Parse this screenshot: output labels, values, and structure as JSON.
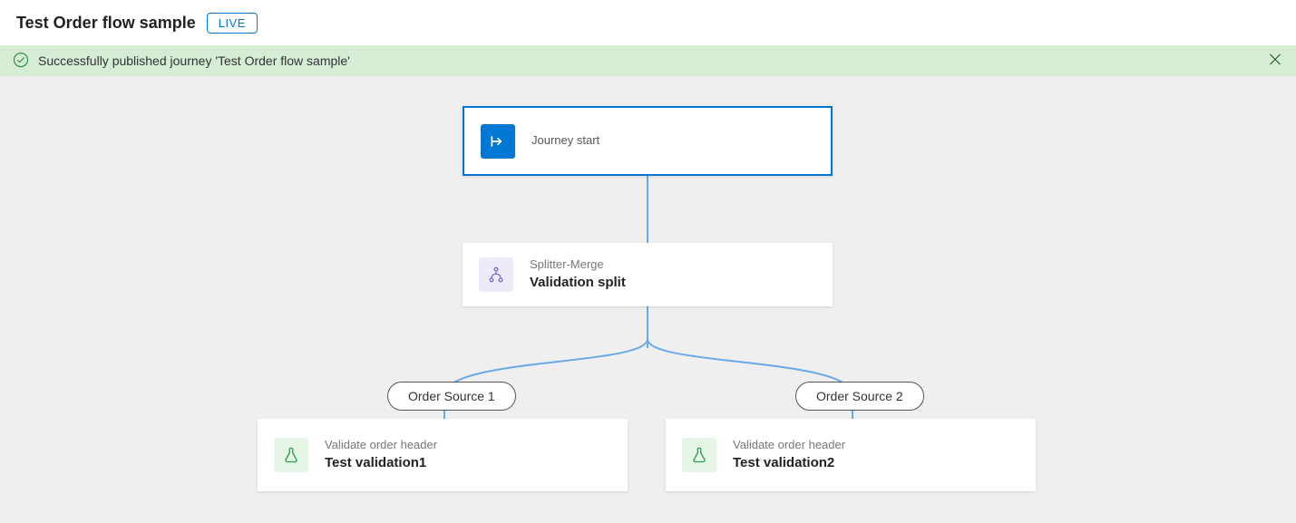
{
  "header": {
    "title": "Test Order flow sample",
    "badge": "LIVE"
  },
  "alert": {
    "message": "Successfully published journey 'Test Order flow sample'"
  },
  "nodes": {
    "start": {
      "label": "Journey start"
    },
    "split": {
      "type": "Splitter-Merge",
      "name": "Validation split"
    },
    "branch1": {
      "pill": "Order Source 1",
      "type": "Validate order header",
      "name": "Test validation1"
    },
    "branch2": {
      "pill": "Order Source 2",
      "type": "Validate order header",
      "name": "Test validation2"
    }
  }
}
